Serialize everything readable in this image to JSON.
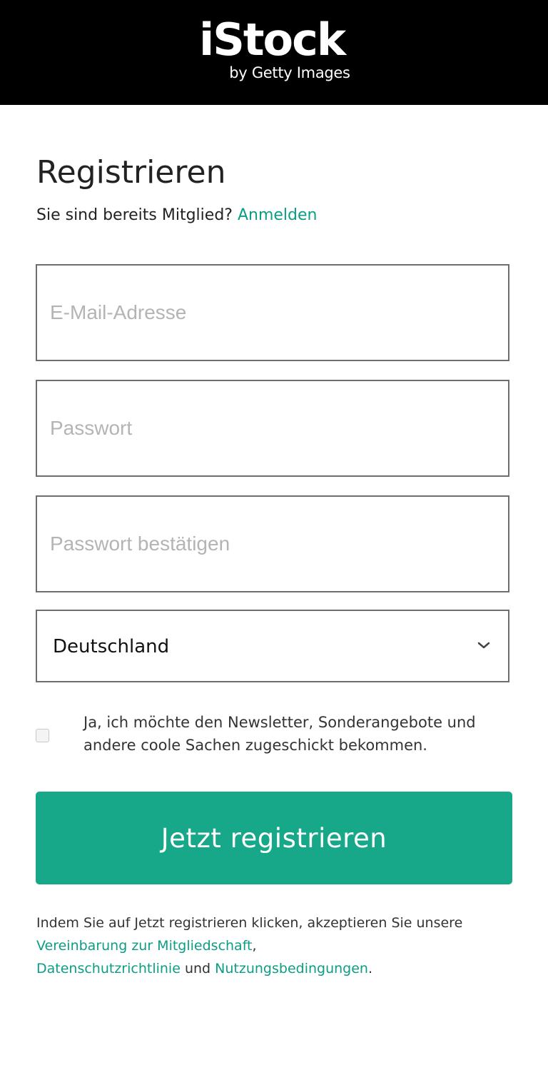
{
  "brand": {
    "name": "iStock",
    "tagline": "by Getty Images"
  },
  "signup": {
    "title": "Registrieren",
    "member_prompt": "Sie sind bereits Mitglied?",
    "login_link": "Anmelden"
  },
  "form": {
    "email": {
      "placeholder": "E-Mail-Adresse",
      "value": ""
    },
    "password": {
      "placeholder": "Passwort",
      "value": ""
    },
    "password_confirm": {
      "placeholder": "Passwort bestätigen",
      "value": ""
    },
    "country": {
      "selected": "Deutschland"
    },
    "newsletter": {
      "checked": false,
      "label": "Ja, ich möchte den Newsletter, Sonderangebote und andere coole Sachen zugeschickt bekommen."
    },
    "submit_label": "Jetzt registrieren"
  },
  "legal": {
    "prefix": "Indem Sie auf Jetzt registrieren klicken, akzeptieren Sie unsere",
    "membership_link": "Vereinbarung zur Mitgliedschaft",
    "separator": ",",
    "privacy_link": "Datenschutzrichtlinie",
    "conjunction": "und",
    "terms_link": "Nutzungsbedingungen",
    "suffix": "."
  },
  "colors": {
    "header_bg": "#000000",
    "accent": "#17a88a",
    "link": "#0c9e84",
    "border": "#6e6e6e",
    "placeholder": "#b4b4b4"
  },
  "icons": {
    "select_arrow": "chevron-down-icon",
    "newsletter_checkbox": "checkbox-unchecked"
  }
}
